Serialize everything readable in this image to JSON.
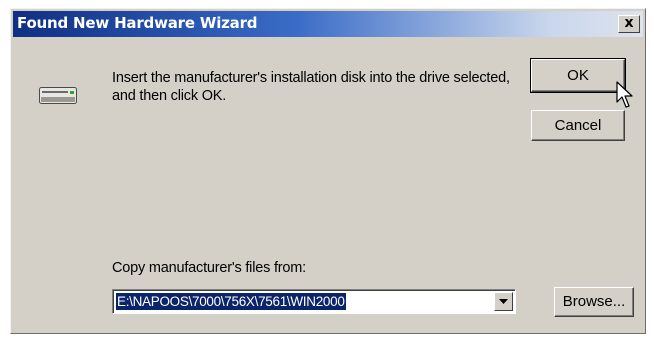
{
  "window": {
    "title": "Found New Hardware Wizard",
    "close_glyph": "x"
  },
  "icons": {
    "drive": "floppy-drive-icon",
    "cursor": "mouse-pointer-icon",
    "dropdown": "chevron-down-icon"
  },
  "message": {
    "text": "Insert the manufacturer's installation disk into the drive selected, and then click OK."
  },
  "buttons": {
    "ok_label": "OK",
    "cancel_label": "Cancel",
    "browse_label": "Browse..."
  },
  "copy_from": {
    "label": "Copy manufacturer's files from:",
    "value": "E:\\NAPOOS\\7000\\756X\\7561\\WIN2000"
  },
  "colors": {
    "title_bar_start": "#0f2f84",
    "dialog_face": "#d4d0c8",
    "selection": "#0a246a"
  }
}
